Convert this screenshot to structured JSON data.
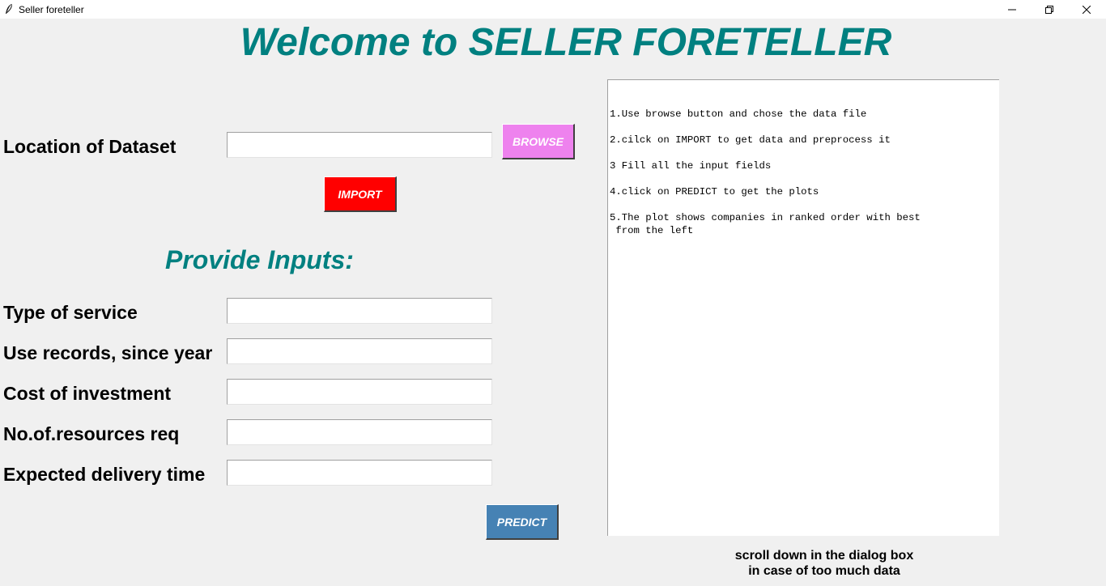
{
  "window": {
    "title": "Seller foreteller",
    "icon": "feather-icon"
  },
  "heading": "Welcome to SELLER FORETELLER",
  "dataset": {
    "label": "Location of Dataset",
    "value": "",
    "browse_label": "BROWSE",
    "import_label": "IMPORT"
  },
  "inputs_heading": "Provide Inputs:",
  "inputs": [
    {
      "label": "Type of service",
      "value": ""
    },
    {
      "label": "Use records, since year",
      "value": ""
    },
    {
      "label": "Cost of investment",
      "value": ""
    },
    {
      "label": "No.of.resources req",
      "value": ""
    },
    {
      "label": "Expected delivery time",
      "value": ""
    }
  ],
  "predict_label": "PREDICT",
  "instructions": [
    "1.Use browse button and chose the data file",
    "2.cilck on IMPORT to get data and preprocess it",
    "3 Fill all the input fields",
    "4.click on PREDICT to get the plots",
    "5.The plot shows companies in ranked order with best",
    " from the left"
  ],
  "note": {
    "line1": "scroll down in the dialog box",
    "line2": "in case of too much data"
  },
  "colors": {
    "accent": "#008080",
    "browse": "#ee82ee",
    "import": "#ff0000",
    "predict": "#4682b4"
  }
}
